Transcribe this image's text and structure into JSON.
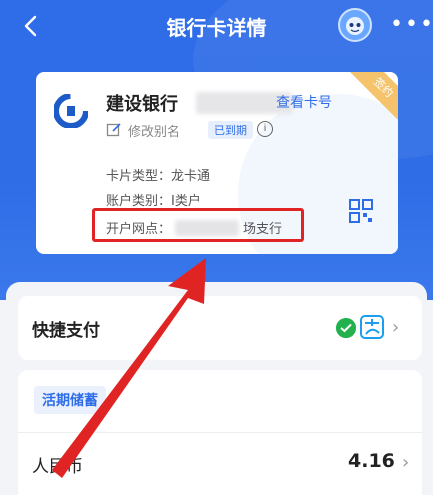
{
  "header": {
    "title": "银行卡详情",
    "more": "•••"
  },
  "card": {
    "bank_name": "建设银行",
    "view_card_label": "查看卡号",
    "corner_tag": "签约",
    "edit_alias_label": "修改别名",
    "status_badge": "已到期",
    "info_symbol": "i",
    "card_type_label": "卡片类型：",
    "card_type_value": "龙卡通",
    "account_type_label": "账户类别：",
    "account_type_value": "I类户",
    "branch_label": "开户网点：",
    "branch_suffix": "场支行"
  },
  "quick_pay": {
    "label": "快捷支付",
    "chevron": "›"
  },
  "savings": {
    "tag": "活期储蓄",
    "currency_label": "人民币",
    "amount": "4.16",
    "chevron": "›"
  },
  "colors": {
    "brand_blue": "#2f6de8",
    "annotation_red": "#e02424",
    "corner_gold": "#f4c36c"
  }
}
